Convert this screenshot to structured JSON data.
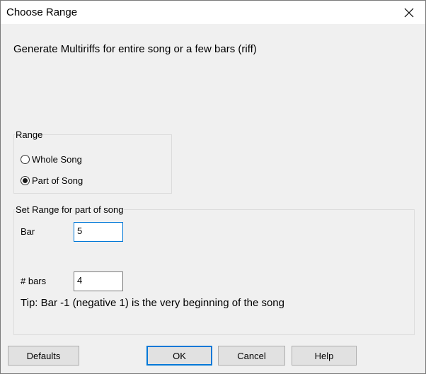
{
  "window": {
    "title": "Choose Range",
    "close_icon": "close-icon"
  },
  "intro_text": "Generate Multiriffs for entire song or a few bars (riff)",
  "range_group": {
    "legend": "Range",
    "options": [
      {
        "label": "Whole Song",
        "checked": false
      },
      {
        "label": "Part of Song",
        "checked": true
      }
    ]
  },
  "set_range_group": {
    "legend": "Set Range for part of song",
    "bar_label": "Bar",
    "bar_value": "5",
    "num_bars_label": "# bars",
    "num_bars_value": "4",
    "tip": "Tip: Bar -1 (negative 1) is the very beginning of the song"
  },
  "buttons": {
    "defaults": "Defaults",
    "ok": "OK",
    "cancel": "Cancel",
    "help": "Help"
  },
  "colors": {
    "focus_accent": "#0078d7",
    "dialog_bg": "#f0f0f0"
  }
}
